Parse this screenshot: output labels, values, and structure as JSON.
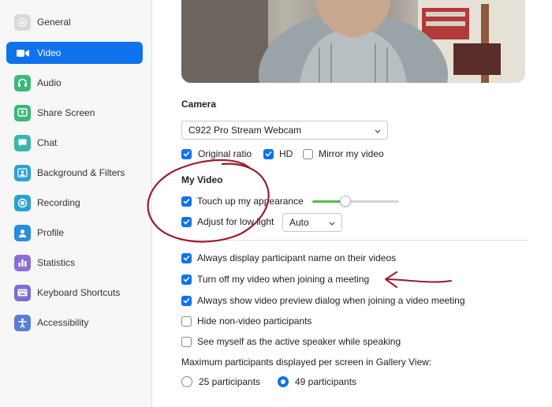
{
  "sidebar": {
    "items": [
      {
        "label": "General",
        "icon": "gear-icon",
        "color": "#d9d9d9",
        "active": false
      },
      {
        "label": "Video",
        "icon": "video-camera-icon",
        "color": "#0e72ed",
        "active": true
      },
      {
        "label": "Audio",
        "icon": "headphones-icon",
        "color": "#3cb878",
        "active": false
      },
      {
        "label": "Share Screen",
        "icon": "share-screen-icon",
        "color": "#3cb878",
        "active": false
      },
      {
        "label": "Chat",
        "icon": "chat-bubble-icon",
        "color": "#3ab5ae",
        "active": false
      },
      {
        "label": "Background & Filters",
        "icon": "background-person-icon",
        "color": "#2aa1d6",
        "active": false
      },
      {
        "label": "Recording",
        "icon": "record-icon",
        "color": "#2aa1d6",
        "active": false
      },
      {
        "label": "Profile",
        "icon": "profile-person-icon",
        "color": "#2a8be0",
        "active": false
      },
      {
        "label": "Statistics",
        "icon": "bar-chart-icon",
        "color": "#8c6fd6",
        "active": false
      },
      {
        "label": "Keyboard Shortcuts",
        "icon": "keyboard-icon",
        "color": "#7a6fd6",
        "active": false
      },
      {
        "label": "Accessibility",
        "icon": "accessibility-icon",
        "color": "#5a7dd6",
        "active": false
      }
    ]
  },
  "camera": {
    "title": "Camera",
    "selected": "C922 Pro Stream Webcam",
    "original_ratio": {
      "label": "Original ratio",
      "checked": true
    },
    "hd": {
      "label": "HD",
      "checked": true
    },
    "mirror": {
      "label": "Mirror my video",
      "checked": false
    }
  },
  "my_video": {
    "title": "My Video",
    "touch_up": {
      "label": "Touch up my appearance",
      "checked": true,
      "level": 0.38
    },
    "low_light": {
      "label": "Adjust for low light",
      "checked": true,
      "mode": "Auto"
    }
  },
  "options": [
    {
      "label": "Always display participant name on their videos",
      "checked": true
    },
    {
      "label": "Turn off my video when joining a meeting",
      "checked": true
    },
    {
      "label": "Always show video preview dialog when joining a video meeting",
      "checked": true
    },
    {
      "label": "Hide non-video participants",
      "checked": false
    },
    {
      "label": "See myself as the active speaker while speaking",
      "checked": false
    }
  ],
  "gallery": {
    "label": "Maximum participants displayed per screen in Gallery View:",
    "options": [
      {
        "label": "25 participants",
        "selected": false
      },
      {
        "label": "49 participants",
        "selected": true
      }
    ]
  },
  "colors": {
    "accent": "#0e72ed",
    "annotation": "#9b1b2c",
    "slider": "#4cc04c"
  }
}
